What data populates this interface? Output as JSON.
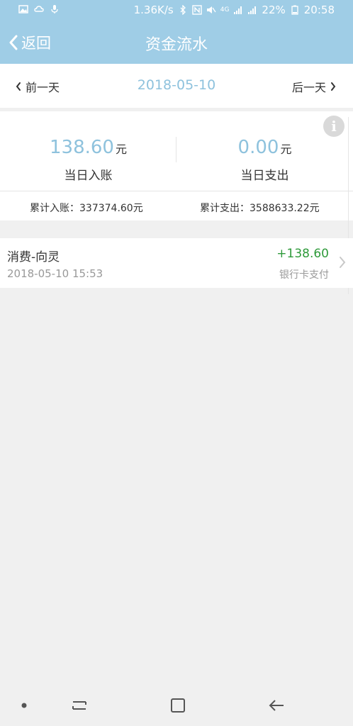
{
  "status_bar": {
    "net_speed": "1.36K/s",
    "network_4g": "4G",
    "battery": "22%",
    "time": "20:58",
    "icons_left": [
      "image-icon",
      "cloud-icon",
      "mic-off-icon"
    ],
    "icons_right": [
      "bluetooth-icon",
      "nfc-icon",
      "mute-icon",
      "signal-icon",
      "signal-icon",
      "battery-icon"
    ]
  },
  "header": {
    "back_label": "返回",
    "title": "资金流水"
  },
  "date_nav": {
    "prev_label": "前一天",
    "date": "2018-05-10",
    "next_label": "后一天"
  },
  "summary": {
    "income_amount": "138.60",
    "income_unit": "元",
    "income_label": "当日入账",
    "expense_amount": "0.00",
    "expense_unit": "元",
    "expense_label": "当日支出",
    "total_income": "累计入账：337374.60元",
    "total_expense": "累计支出：3588633.22元",
    "info_icon_glyph": "i"
  },
  "records": [
    {
      "title": "消费-向灵",
      "time": "2018-05-10 15:53",
      "amount": "+138.60",
      "method": "银行卡支付"
    }
  ],
  "colors": {
    "header_bg": "#9fcde6",
    "accent_amount": "#8ec2dd",
    "positive": "#2e9a3a"
  }
}
